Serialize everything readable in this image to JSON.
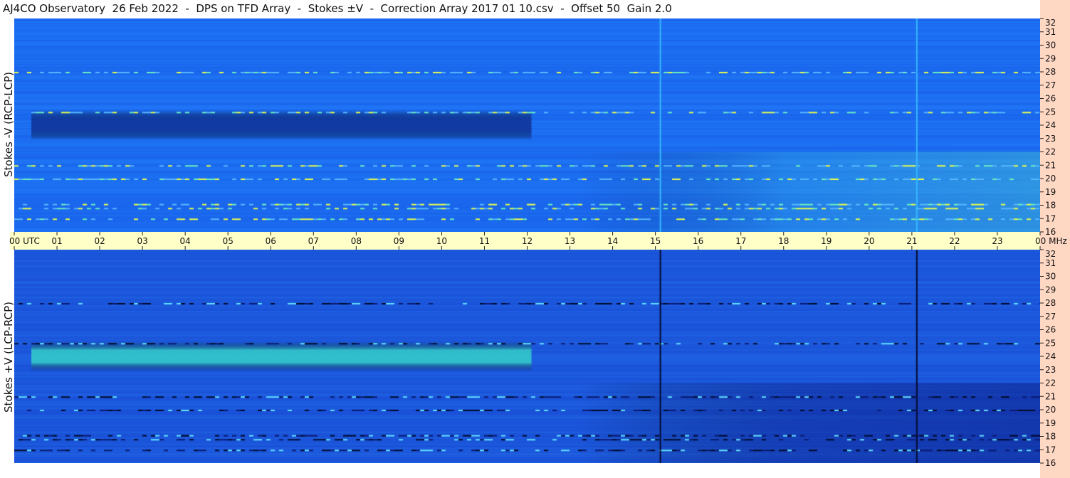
{
  "title": "AJ4CO Observatory  26 Feb 2022  -  DPS on TFD Array  -  Stokes ±V  -  Correction Array 2017 01 10.csv  -  Offset 50  Gain 2.0",
  "chart_data": [
    {
      "type": "heatmap",
      "panel": "top",
      "ylabel": "Stokes -V (RCP-LCP)",
      "x_ticks": [
        "00 UTC",
        "01",
        "02",
        "03",
        "04",
        "05",
        "06",
        "07",
        "08",
        "09",
        "10",
        "11",
        "12",
        "13",
        "14",
        "15",
        "16",
        "17",
        "18",
        "19",
        "20",
        "21",
        "22",
        "23",
        "00 MHz"
      ],
      "y_ticks": [
        16,
        17,
        18,
        19,
        20,
        21,
        22,
        23,
        24,
        25,
        26,
        27,
        28,
        29,
        30,
        31,
        32
      ],
      "xlim": [
        0,
        24
      ],
      "ylim": [
        16,
        32
      ],
      "base_color": "#1c6cf0",
      "features": [
        {
          "name": "dark-band",
          "x": [
            0.4,
            12.1
          ],
          "y": [
            23.3,
            24.7
          ],
          "color": "#0f2f8f"
        },
        {
          "name": "bright-lines",
          "y": [
            17.0,
            17.8,
            18.1,
            20.0,
            21.0,
            25.0,
            28.0
          ]
        },
        {
          "name": "vertical-lines",
          "x": [
            15.1,
            21.1
          ],
          "color": "#34b8ff"
        }
      ]
    },
    {
      "type": "heatmap",
      "panel": "bottom",
      "ylabel": "Stokes +V (LCP-RCP)",
      "y_ticks": [
        16,
        17,
        18,
        19,
        20,
        21,
        22,
        23,
        24,
        25,
        26,
        27,
        28,
        29,
        30,
        31,
        32
      ],
      "xlim": [
        0,
        24
      ],
      "ylim": [
        16,
        32
      ],
      "base_color": "#1c58dc",
      "features": [
        {
          "name": "bright-band",
          "x": [
            0.4,
            12.1
          ],
          "y": [
            23.3,
            24.7
          ],
          "color": "#36d6c8"
        },
        {
          "name": "dark-lines",
          "y": [
            17.0,
            17.8,
            18.1,
            20.0,
            21.0,
            25.0,
            28.0
          ]
        },
        {
          "name": "vertical-lines",
          "x": [
            15.1,
            21.1
          ],
          "color": "#050a30"
        }
      ]
    }
  ]
}
